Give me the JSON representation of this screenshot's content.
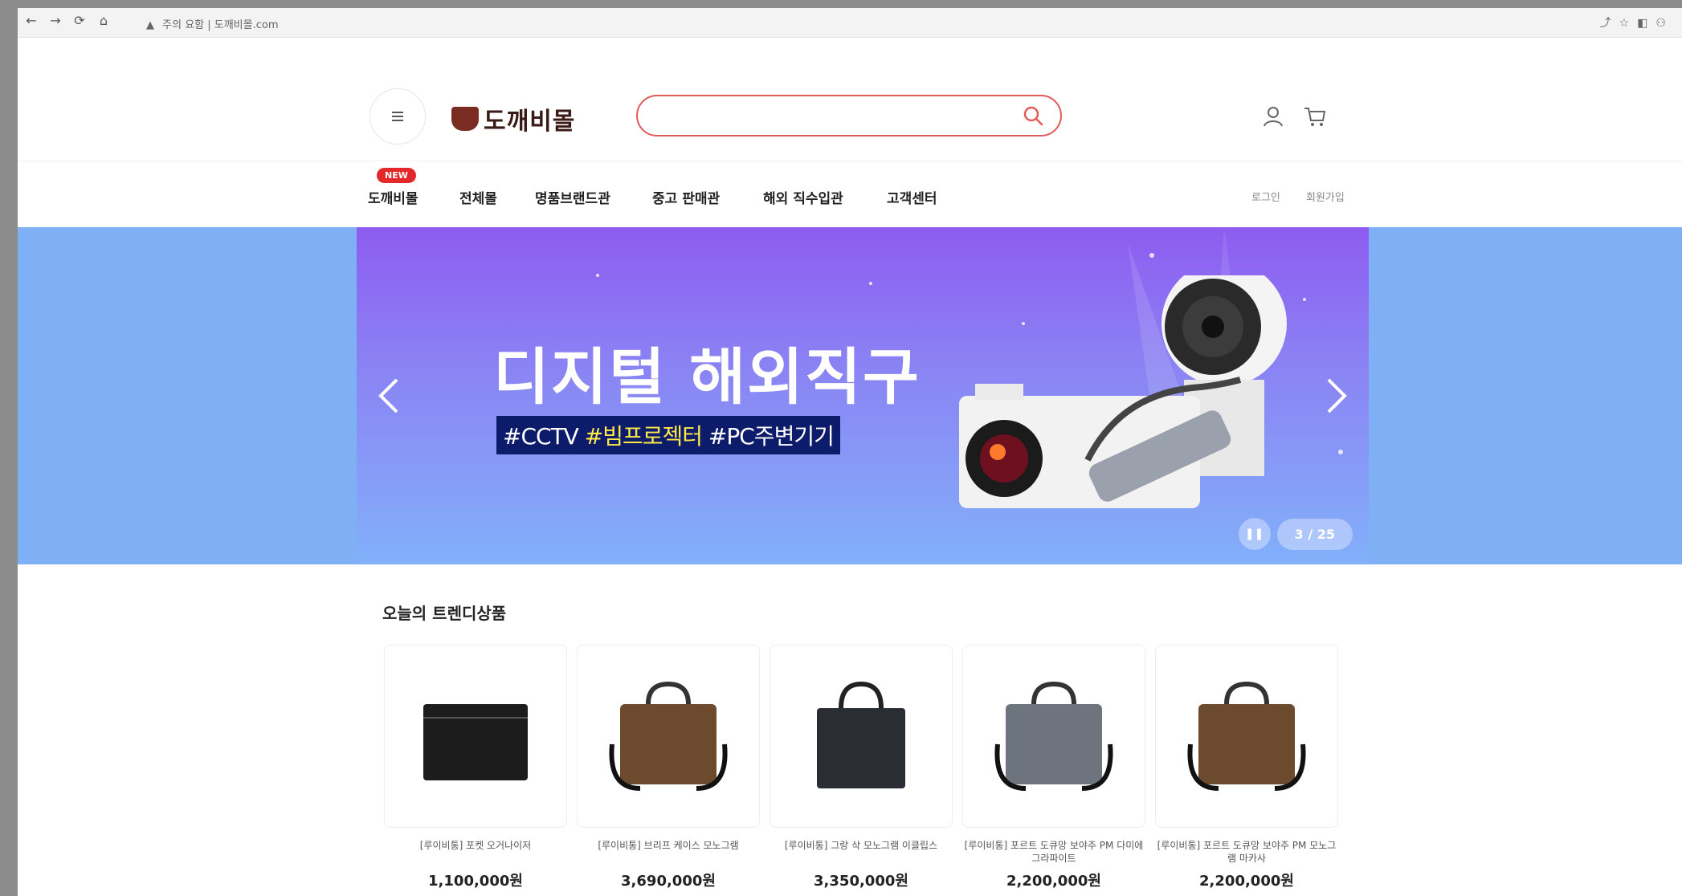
{
  "browser": {
    "address": "주의 요함 | 도깨비몰.com",
    "back": "←",
    "forward": "→",
    "reload": "⟳",
    "home": "⌂"
  },
  "header": {
    "logo": "도깨비몰",
    "search_placeholder": ""
  },
  "gnb": {
    "badge": "NEW",
    "items": [
      "도깨비몰",
      "전체몰",
      "명품브랜드관",
      "중고 판매관",
      "해외 직수입관",
      "고객센터"
    ],
    "util": [
      "로그인",
      "회원가입"
    ]
  },
  "banner": {
    "title": "디지털 해외직구",
    "tag1": "#CCTV",
    "tag2": "#빔프로젝터",
    "tag3": "#PC주변기기",
    "counter": "3 / 25"
  },
  "products": {
    "section_title": "오늘의 트렌디상품",
    "items": [
      {
        "name": "[루이비통] 포켓 오거나이저",
        "price": "1,100,000원",
        "color": "#1c1c1c"
      },
      {
        "name": "[루이비통] 브리프 케이스 모노그램",
        "price": "3,690,000원",
        "color": "#6b4a2e"
      },
      {
        "name": "[루이비통] 그랑 삭 모노그램 이클립스",
        "price": "3,350,000원",
        "color": "#2a2d33"
      },
      {
        "name": "[루이비통] 포르트 도큐망 보야주 PM 다미에 그라파이트",
        "price": "2,200,000원",
        "color": "#6e747e"
      },
      {
        "name": "[루이비통] 포르트 도큐망 보야주 PM 모노그램 마카사",
        "price": "2,200,000원",
        "color": "#6b4a2e"
      }
    ]
  },
  "colors": {
    "search_border": "#e25b5b",
    "banner_bg": "#7fb0f6",
    "badge": "#e2282b"
  }
}
